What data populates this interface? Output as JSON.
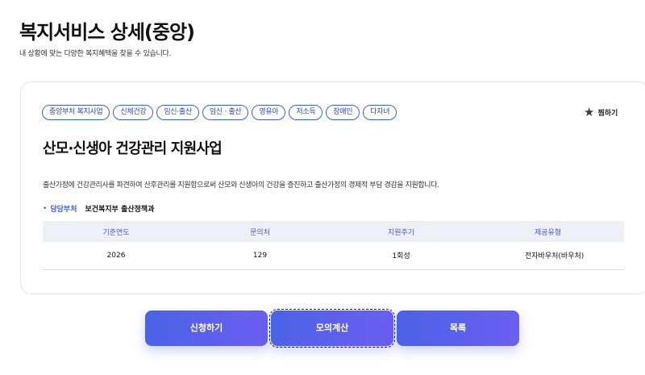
{
  "page": {
    "title": "복지서비스 상세(중앙)",
    "subtitle": "내 상황에 맞는 다양한 복지혜택을 찾을 수 있습니다."
  },
  "service": {
    "tags": [
      "중앙부처 복지사업",
      "신체건강",
      "임신·출산",
      "임신 · 출산",
      "영유아",
      "저소득",
      "장애인",
      "다자녀"
    ],
    "favorite_label": "찜하기",
    "title": "산모·신생아 건강관리 지원사업",
    "description": "출산가정에 건강관리사를 파견하여 산후관리를 지원함으로써 산모와 신생아의 건강을 증진하고 출산가정의 경제적 부담 경감을 지원합니다.",
    "department_label": "담당부처",
    "department_value": "보건복지부 출산정책과",
    "table": {
      "headers": [
        "기준연도",
        "문의처",
        "지원주기",
        "제공유형"
      ],
      "row": [
        "2026",
        "129",
        "1회성",
        "전자바우처(바우처)"
      ]
    }
  },
  "buttons": {
    "apply": "신청하기",
    "calculate": "모의계산",
    "list": "목록"
  },
  "colors": {
    "accent": "#3d5ee0",
    "button_gradient_start": "#4a63e6",
    "button_gradient_end": "#6b5ef0"
  }
}
